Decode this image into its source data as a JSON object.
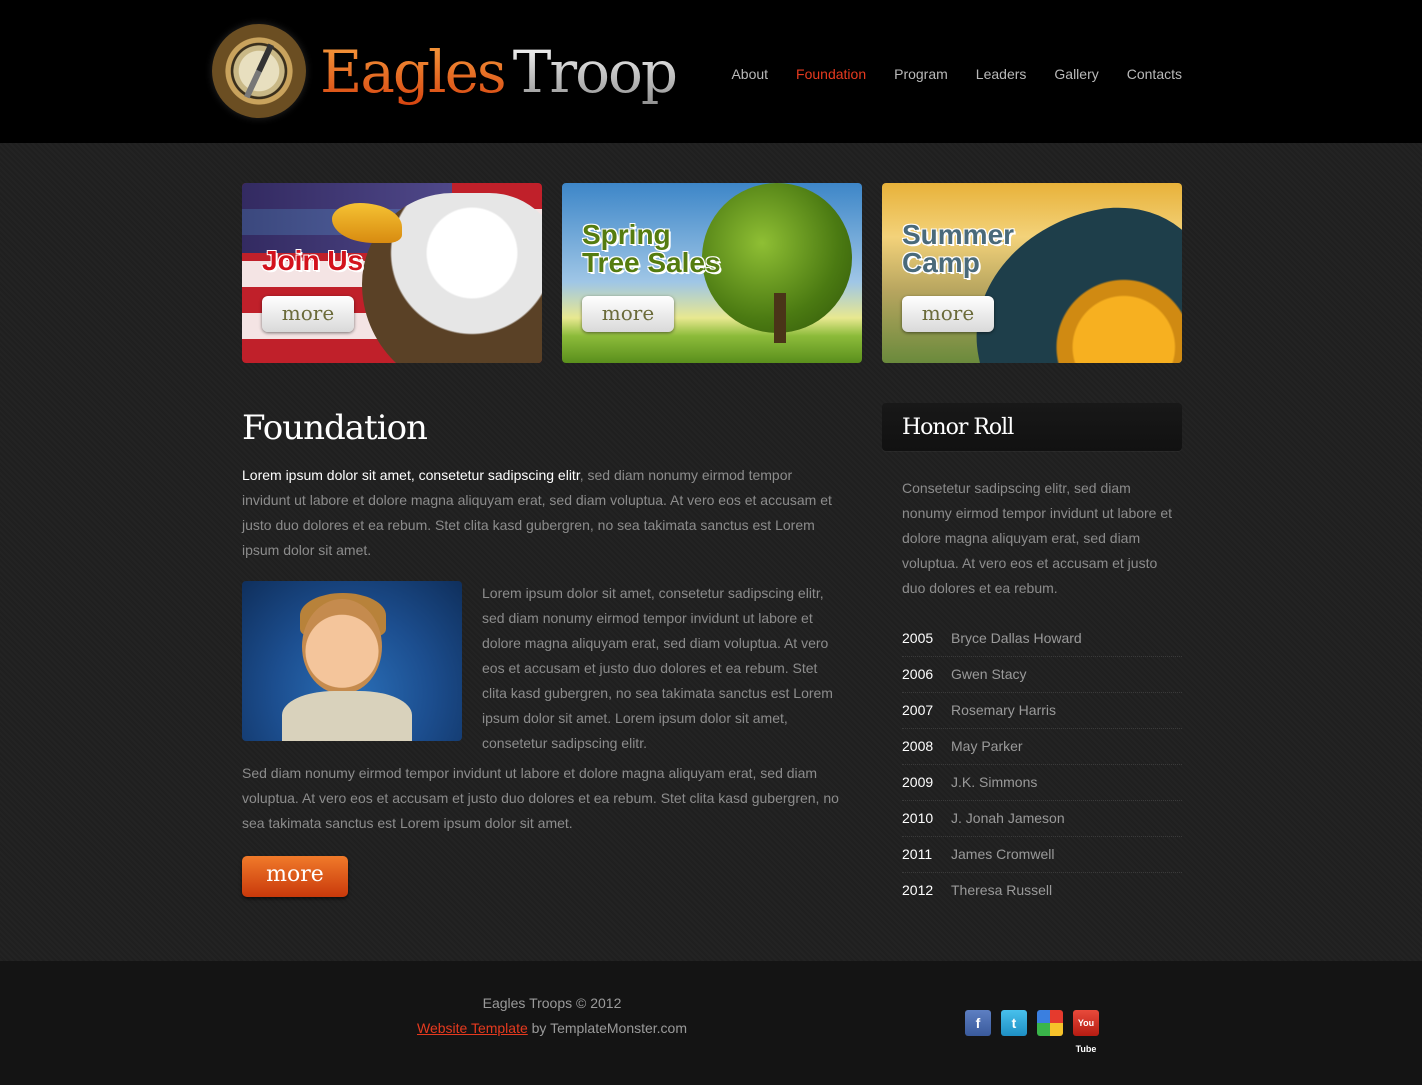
{
  "header": {
    "logo": {
      "word1": "Eagles",
      "word2": "Troop"
    },
    "nav": [
      {
        "label": "About",
        "active": false
      },
      {
        "label": "Foundation",
        "active": true
      },
      {
        "label": "Program",
        "active": false
      },
      {
        "label": "Leaders",
        "active": false
      },
      {
        "label": "Gallery",
        "active": false
      },
      {
        "label": "Contacts",
        "active": false
      }
    ]
  },
  "banners": [
    {
      "title": "Join Us",
      "button": "more"
    },
    {
      "title": "Spring\nTree Sales",
      "button": "more"
    },
    {
      "title": "Summer\nCamp",
      "button": "more"
    }
  ],
  "main": {
    "title": "Foundation",
    "intro_lead": "Lorem ipsum dolor sit amet, consetetur sadipscing elitr",
    "intro_rest": ", sed diam nonumy eirmod tempor invidunt ut labore et dolore magna aliquyam erat, sed diam voluptua. At vero eos et accusam et justo duo dolores et ea rebum. Stet clita kasd gubergren, no sea takimata sanctus est Lorem ipsum dolor sit amet.",
    "side_text": "Lorem ipsum dolor sit amet, consetetur sadipscing elitr, sed diam nonumy eirmod tempor invidunt ut labore et dolore magna aliquyam erat, sed diam voluptua. At vero eos et accusam et justo duo dolores et ea rebum. Stet clita kasd gubergren, no sea takimata sanctus est Lorem ipsum dolor sit amet. Lorem ipsum dolor sit amet, consetetur sadipscing elitr.",
    "outro": "Sed diam nonumy eirmod tempor invidunt ut labore et dolore magna aliquyam erat, sed diam voluptua. At vero eos et accusam et justo duo dolores et ea rebum. Stet clita kasd gubergren, no sea takimata sanctus est Lorem ipsum dolor sit amet.",
    "more_button": "more"
  },
  "sidebar": {
    "title": "Honor Roll",
    "text": "Consetetur sadipscing elitr, sed diam nonumy eirmod tempor invidunt ut labore et dolore magna aliquyam erat, sed diam voluptua. At vero eos et accusam et justo duo dolores et ea rebum.",
    "honors": [
      {
        "year": "2005",
        "name": "Bryce Dallas Howard"
      },
      {
        "year": "2006",
        "name": "Gwen Stacy"
      },
      {
        "year": "2007",
        "name": "Rosemary Harris"
      },
      {
        "year": "2008",
        "name": "May Parker"
      },
      {
        "year": "2009",
        "name": "J.K. Simmons"
      },
      {
        "year": "2010",
        "name": "J. Jonah Jameson"
      },
      {
        "year": "2011",
        "name": "James Cromwell"
      },
      {
        "year": "2012",
        "name": "Theresa Russell"
      }
    ]
  },
  "footer": {
    "copyright": "Eagles Troops © 2012",
    "link_text": "Website Template",
    "by_text": " by TemplateMonster.com",
    "social": [
      {
        "icon": "facebook-icon",
        "glyph": "f"
      },
      {
        "icon": "twitter-icon",
        "glyph": "t"
      },
      {
        "icon": "picasa-icon",
        "glyph": ""
      },
      {
        "icon": "youtube-icon",
        "glyph": "You Tube"
      }
    ]
  },
  "colors": {
    "accent": "#e63a1f",
    "brand_orange": "#e4631d",
    "background": "#202020",
    "header_bg": "#000000"
  }
}
